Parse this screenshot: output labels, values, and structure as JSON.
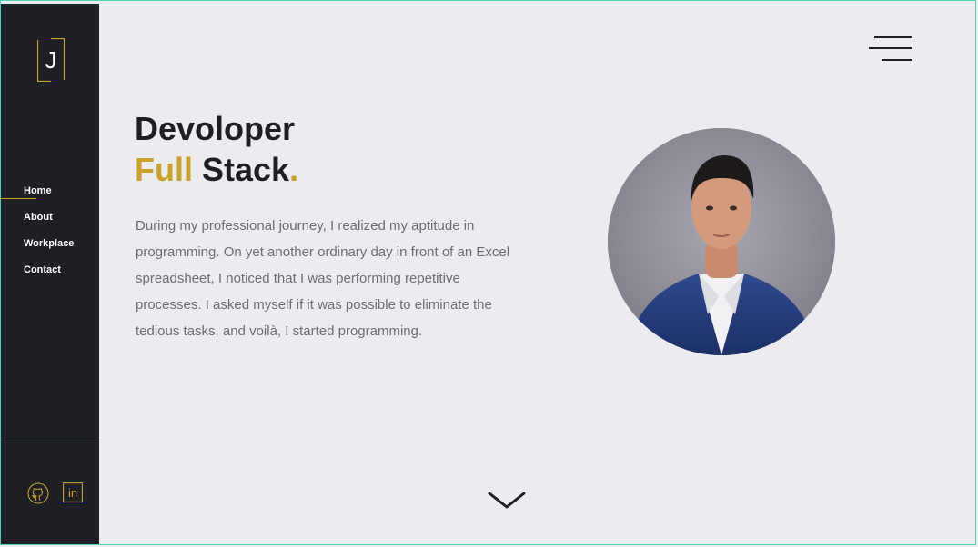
{
  "sidebar": {
    "logo_letter": "J",
    "nav": [
      {
        "label": "Home",
        "active": true
      },
      {
        "label": "About",
        "active": false
      },
      {
        "label": "Workplace",
        "active": false
      },
      {
        "label": "Contact",
        "active": false
      }
    ],
    "social": [
      {
        "name": "github-icon"
      },
      {
        "name": "linkedin-icon",
        "text": "in"
      }
    ]
  },
  "hero": {
    "title_line1": "Devoloper",
    "title_line2_accent": "Full",
    "title_line2_rest": " Stack",
    "title_dot": ".",
    "description": "During my professional journey, I realized my aptitude in programming. On yet another ordinary day in front of an Excel spreadsheet, I noticed that I was performing repetitive processes. I asked myself if it was possible to eliminate the tedious tasks, and voilà, I started programming."
  },
  "colors": {
    "accent": "#c9a227",
    "sidebar_bg": "#1d1f25",
    "page_bg": "#ecebef",
    "text_muted": "#6d6d78",
    "frame_border": "#4fd1b5"
  },
  "icons": {
    "menu": "hamburger-menu-icon",
    "scroll": "chevron-down-icon"
  }
}
